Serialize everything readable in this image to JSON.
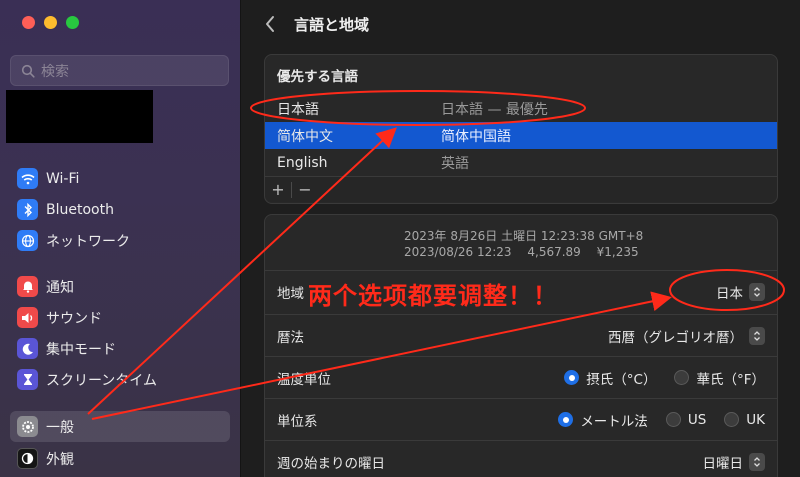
{
  "window": {
    "title": "言語と地域"
  },
  "sidebar": {
    "search_placeholder": "検索",
    "items": [
      {
        "label": "Wi-Fi",
        "icon": "wifi-icon"
      },
      {
        "label": "Bluetooth",
        "icon": "bluetooth-icon"
      },
      {
        "label": "ネットワーク",
        "icon": "globe-icon"
      },
      {
        "label": "通知",
        "icon": "bell-icon"
      },
      {
        "label": "サウンド",
        "icon": "speaker-icon"
      },
      {
        "label": "集中モード",
        "icon": "moon-icon"
      },
      {
        "label": "スクリーンタイム",
        "icon": "hourglass-icon"
      },
      {
        "label": "一般",
        "icon": "gear-icon",
        "selected": true
      },
      {
        "label": "外観",
        "icon": "appearance-icon"
      }
    ]
  },
  "preferred_languages": {
    "heading": "優先する言語",
    "rows": [
      {
        "name": "日本語",
        "desc": "日本語 — 最優先"
      },
      {
        "name": "简体中文",
        "desc": "简体中国語",
        "selected": true
      },
      {
        "name": "English",
        "desc": "英語"
      }
    ],
    "add_label": "+",
    "remove_label": "−"
  },
  "format": {
    "preview_line1": "2023年 8月26日 土曜日 12:23:38 GMT+8",
    "preview_line2": "2023/08/26 12:23　 4,567.89　 ¥1,235",
    "region": {
      "label": "地域",
      "value": "日本"
    },
    "calendar": {
      "label": "暦法",
      "value": "西暦（グレゴリオ暦）"
    },
    "temperature": {
      "label": "温度単位",
      "options": [
        "摂氏（°C）",
        "華氏（°F）"
      ],
      "selected": 0
    },
    "measurement": {
      "label": "単位系",
      "options": [
        "メートル法",
        "US",
        "UK"
      ],
      "selected": 0
    },
    "first_day": {
      "label": "週の始まりの曜日",
      "value": "日曜日"
    }
  },
  "annotation": {
    "text": "两个选项都要调整！！",
    "color": "#ff2a1a"
  },
  "colors": {
    "accent": "#1358d0",
    "annotation": "#ff2a1a"
  }
}
